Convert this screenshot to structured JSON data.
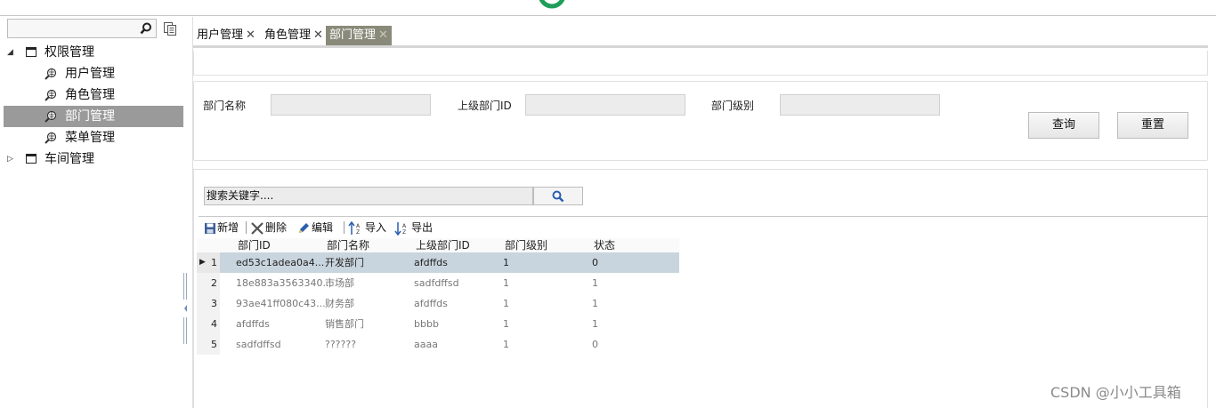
{
  "sidebar": {
    "search_placeholder": "",
    "tree": [
      {
        "label": "权限管理",
        "expanded": true,
        "children": [
          {
            "label": "用户管理",
            "selected": false
          },
          {
            "label": "角色管理",
            "selected": false
          },
          {
            "label": "部门管理",
            "selected": true
          },
          {
            "label": "菜单管理",
            "selected": false
          }
        ]
      },
      {
        "label": "车间管理",
        "expanded": false,
        "children": []
      }
    ]
  },
  "tabs": [
    {
      "label": "用户管理",
      "close": "✕",
      "active": false
    },
    {
      "label": "角色管理",
      "close": "✕",
      "active": false
    },
    {
      "label": "部门管理",
      "close": "✕",
      "active": true
    }
  ],
  "query": {
    "fields": [
      {
        "label": "部门名称",
        "value": ""
      },
      {
        "label": "上级部门ID",
        "value": ""
      },
      {
        "label": "部门级别",
        "value": ""
      }
    ],
    "search_button": "查询",
    "reset_button": "重置"
  },
  "grid": {
    "keyword_placeholder": "搜索关键字....",
    "toolbar": {
      "add": "新增",
      "delete": "删除",
      "edit": "编辑",
      "import": "导入",
      "export": "导出"
    },
    "columns": [
      "部门ID",
      "部门名称",
      "上级部门ID",
      "部门级别",
      "状态"
    ],
    "rows": [
      {
        "num": "1",
        "id": "ed53c1adea0a4...",
        "name": "开发部门",
        "parent": "afdffds",
        "level": "1",
        "status": "0",
        "selected": true
      },
      {
        "num": "2",
        "id": "18e883a3563340...",
        "name": "市场部",
        "parent": "sadfdffsd",
        "level": "1",
        "status": "1",
        "selected": false
      },
      {
        "num": "3",
        "id": "93ae41ff080c43...",
        "name": "财务部",
        "parent": "afdffds",
        "level": "1",
        "status": "1",
        "selected": false
      },
      {
        "num": "4",
        "id": "afdffds",
        "name": "销售部门",
        "parent": "bbbb",
        "level": "1",
        "status": "1",
        "selected": false
      },
      {
        "num": "5",
        "id": "sadfdffsd",
        "name": "??????",
        "parent": "aaaa",
        "level": "1",
        "status": "0",
        "selected": false
      }
    ]
  },
  "watermark": "CSDN @小小工具箱",
  "colors": {
    "selected_tree_bg": "#9a9a9a",
    "active_tab_bg": "#8a8a7a",
    "selected_row_bg": "#c9d5de",
    "logo_green": "#1e9e5a",
    "logo_blue": "#2a5fb0"
  }
}
